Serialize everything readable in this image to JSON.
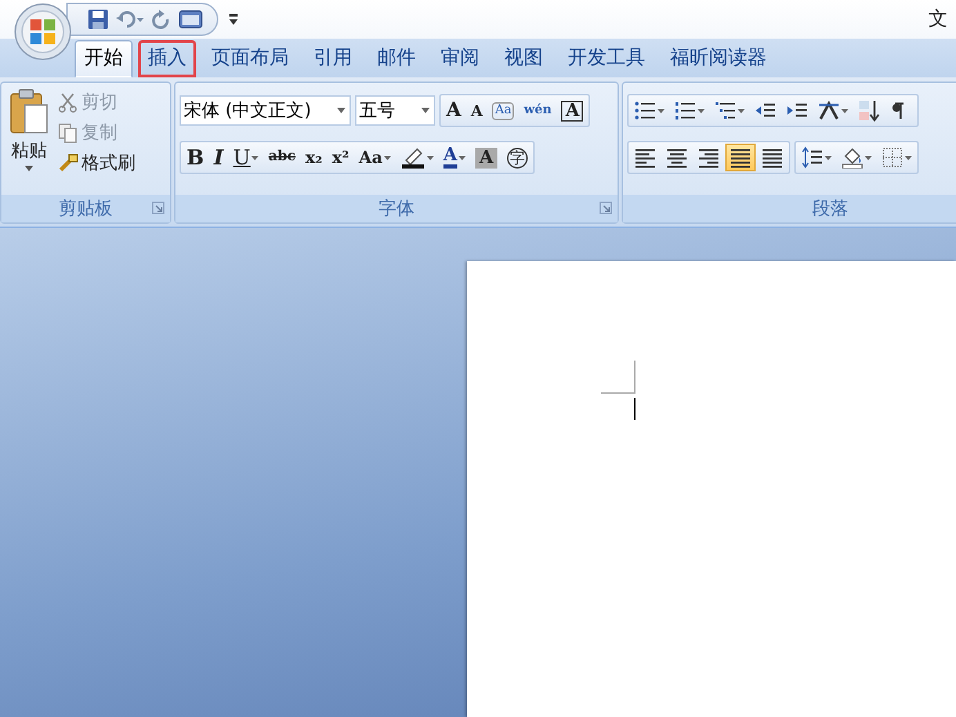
{
  "window": {
    "title": "文"
  },
  "tabs": [
    {
      "label": "开始",
      "selected": true,
      "highlighted": false
    },
    {
      "label": "插入",
      "selected": false,
      "highlighted": true
    },
    {
      "label": "页面布局",
      "selected": false,
      "highlighted": false
    },
    {
      "label": "引用",
      "selected": false,
      "highlighted": false
    },
    {
      "label": "邮件",
      "selected": false,
      "highlighted": false
    },
    {
      "label": "审阅",
      "selected": false,
      "highlighted": false
    },
    {
      "label": "视图",
      "selected": false,
      "highlighted": false
    },
    {
      "label": "开发工具",
      "selected": false,
      "highlighted": false
    },
    {
      "label": "福昕阅读器",
      "selected": false,
      "highlighted": false
    }
  ],
  "clipboard": {
    "label": "剪贴板",
    "paste": "粘贴",
    "commands": [
      {
        "kind": "cut",
        "label": "剪切",
        "disabled": true
      },
      {
        "kind": "copy",
        "label": "复制",
        "disabled": true
      },
      {
        "kind": "painter",
        "label": "格式刷",
        "disabled": false
      }
    ]
  },
  "font": {
    "label": "字体",
    "font_name": "宋体 (中文正文)",
    "font_size": "五号",
    "row_1": [
      {
        "kind": "grow",
        "glyph": "A"
      },
      {
        "kind": "shrink",
        "glyph": "A"
      },
      {
        "kind": "clear",
        "glyph": "Aa"
      },
      {
        "kind": "pinyin",
        "glyph": "wén"
      },
      {
        "kind": "boxed",
        "glyph": "A"
      }
    ],
    "row_2": [
      {
        "kind": "bold",
        "glyph": "B"
      },
      {
        "kind": "italic",
        "glyph": "I"
      },
      {
        "kind": "underline",
        "glyph": "U"
      },
      {
        "kind": "strike",
        "glyph": "abc"
      },
      {
        "kind": "sub",
        "glyph": "x₂"
      },
      {
        "kind": "sup",
        "glyph": "x²"
      },
      {
        "kind": "case",
        "glyph": "Aa"
      },
      {
        "kind": "highlight"
      },
      {
        "kind": "color",
        "glyph": "A"
      },
      {
        "kind": "shaded",
        "glyph": "A"
      },
      {
        "kind": "enclosed",
        "glyph": "字"
      }
    ]
  },
  "paragraph": {
    "label": "段落",
    "row_1": [
      {
        "kind": "bullets"
      },
      {
        "kind": "numbering"
      },
      {
        "kind": "multilevel"
      },
      {
        "kind": "outdent"
      },
      {
        "kind": "indent"
      },
      {
        "kind": "asian"
      },
      {
        "kind": "sort"
      },
      {
        "kind": "marks"
      }
    ],
    "align": [
      {
        "kind": "left",
        "selected": false
      },
      {
        "kind": "center",
        "selected": false
      },
      {
        "kind": "right",
        "selected": false
      },
      {
        "kind": "justify",
        "selected": true
      },
      {
        "kind": "distributed",
        "selected": false
      }
    ],
    "row_2": [
      {
        "kind": "spacing"
      },
      {
        "kind": "shading"
      },
      {
        "kind": "borders"
      }
    ]
  }
}
